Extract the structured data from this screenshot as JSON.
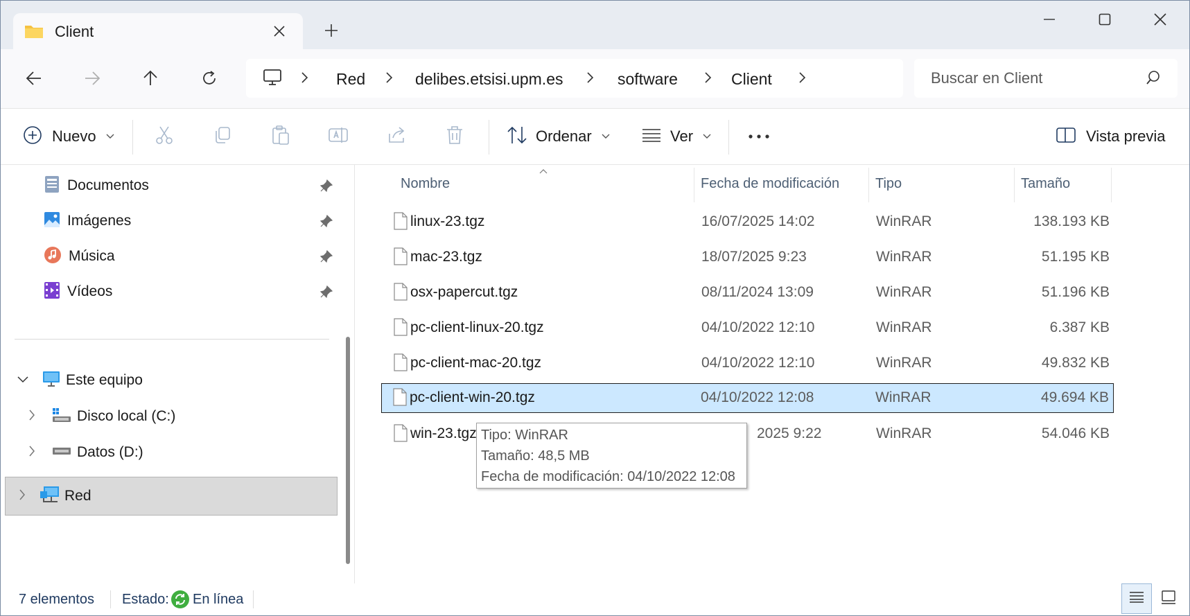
{
  "tab": {
    "title": "Client"
  },
  "breadcrumb": [
    "Red",
    "delibes.etsisi.upm.es",
    "software",
    "Client"
  ],
  "search": {
    "placeholder": "Buscar en Client"
  },
  "toolbar": {
    "new_label": "Nuevo",
    "sort_label": "Ordenar",
    "view_label": "Ver",
    "more_label": "•••",
    "preview_label": "Vista previa"
  },
  "sidebar": {
    "quick": [
      {
        "label": "Documentos",
        "icon": "documents-icon"
      },
      {
        "label": "Imágenes",
        "icon": "pictures-icon"
      },
      {
        "label": "Música",
        "icon": "music-icon"
      },
      {
        "label": "Vídeos",
        "icon": "videos-icon"
      }
    ],
    "tree": [
      {
        "label": "Este equipo",
        "icon": "computer-icon"
      },
      {
        "label": "Disco local (C:)",
        "icon": "drive-c-icon"
      },
      {
        "label": "Datos (D:)",
        "icon": "drive-d-icon"
      },
      {
        "label": "Red",
        "icon": "network-icon"
      }
    ]
  },
  "columns": [
    "Nombre",
    "Fecha de modificación",
    "Tipo",
    "Tamaño"
  ],
  "files": [
    {
      "name": "linux-23.tgz",
      "date": "16/07/2025 14:02",
      "type": "WinRAR",
      "size": "138.193 KB"
    },
    {
      "name": "mac-23.tgz",
      "date": "18/07/2025 9:23",
      "type": "WinRAR",
      "size": "51.195 KB"
    },
    {
      "name": "osx-papercut.tgz",
      "date": "08/11/2024 13:09",
      "type": "WinRAR",
      "size": "51.196 KB"
    },
    {
      "name": "pc-client-linux-20.tgz",
      "date": "04/10/2022 12:10",
      "type": "WinRAR",
      "size": "6.387 KB"
    },
    {
      "name": "pc-client-mac-20.tgz",
      "date": "04/10/2022 12:10",
      "type": "WinRAR",
      "size": "49.832 KB"
    },
    {
      "name": "pc-client-win-20.tgz",
      "date": "04/10/2022 12:08",
      "type": "WinRAR",
      "size": "49.694 KB"
    },
    {
      "name": "win-23.tgz",
      "date": "2025 9:22",
      "type": "WinRAR",
      "size": "54.046 KB"
    }
  ],
  "tooltip": {
    "type": "Tipo: WinRAR",
    "size": "Tamaño: 48,5 MB",
    "date": "Fecha de modificación: 04/10/2022 12:08"
  },
  "status": {
    "count": "7 elementos",
    "state_label": "Estado:",
    "state_value": "En línea"
  },
  "colors": {
    "accent": "#0067c0",
    "selection": "#cce8ff",
    "folder": "#f5c242"
  }
}
